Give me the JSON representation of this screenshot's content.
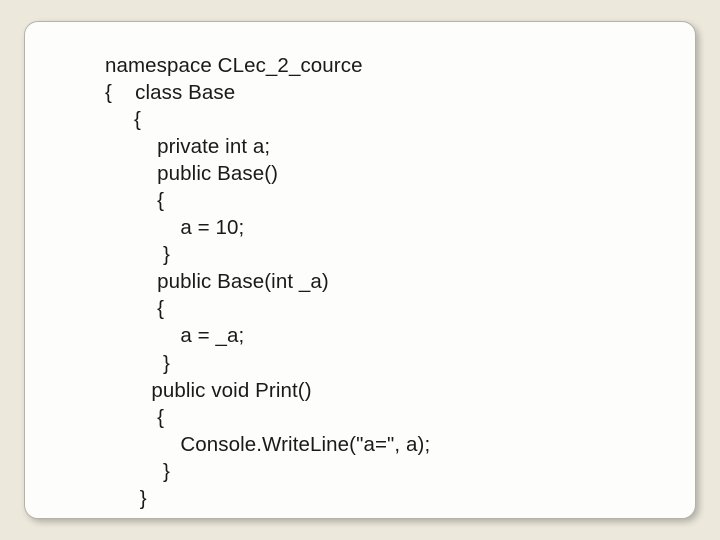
{
  "code": {
    "l1": "namespace CLec_2_cource",
    "l2": "{    class Base",
    "l3": "     {",
    "l4": "         private int a;",
    "l5": "         public Base()",
    "l6": "         {",
    "l7": "             a = 10;",
    "l8": "          }",
    "l9": "         public Base(int _a)",
    "l10": "         {",
    "l11": "             a = _a;",
    "l12": "          }",
    "l13": "        public void Print()",
    "l14": "         {",
    "l15": "             Console.WriteLine(\"a=\", a);",
    "l16": "          }",
    "l17": "      }"
  }
}
